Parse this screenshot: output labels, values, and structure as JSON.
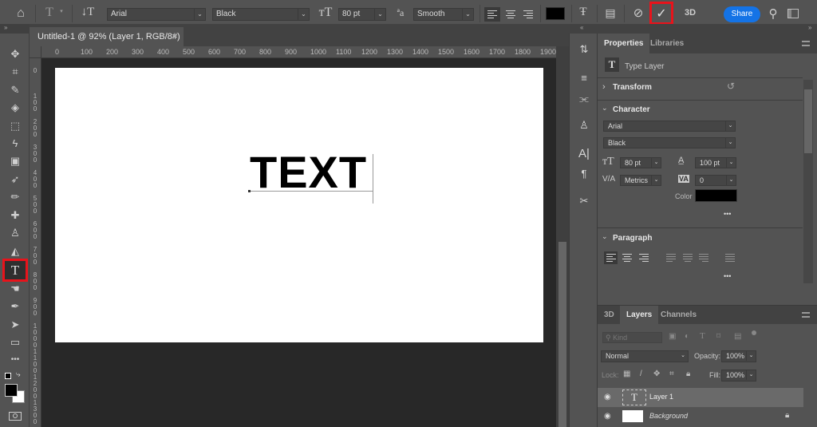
{
  "options_bar": {
    "home_icon": "home-icon",
    "tool_preset_icon": "type-tool-preset-icon",
    "orientation_icon": "text-orientation-icon",
    "font_family": "Arial",
    "font_style": "Black",
    "font_size_icon": "font-size-icon",
    "font_size": "80 pt",
    "antialias_icon": "antialias-icon",
    "antialias": "Smooth",
    "align_left_icon": "align-left-icon",
    "align_center_icon": "align-center-icon",
    "align_right_icon": "align-right-icon",
    "text_color": "#000000",
    "warp_icon": "warp-text-icon",
    "panels_icon": "character-panel-icon",
    "cancel_icon": "cancel-icon",
    "commit_icon": "checkmark-icon",
    "threed_label": "3D",
    "share_label": "Share",
    "search_icon": "search-icon",
    "workspace_icon": "workspace-icon"
  },
  "document": {
    "tab_title": "Untitled-1 @ 92% (Layer 1, RGB/8#)",
    "close_glyph": "×",
    "canvas_text": "TEXT",
    "h_ruler": [
      "0",
      "100",
      "200",
      "300",
      "400",
      "500",
      "600",
      "700",
      "800",
      "900",
      "1000",
      "1100",
      "1200",
      "1300",
      "1400",
      "1500",
      "1600",
      "1700",
      "1800",
      "1900"
    ],
    "v_ruler": [
      "0",
      "100",
      "200",
      "300",
      "400",
      "500",
      "600",
      "700",
      "800",
      "900",
      "1000",
      "1100",
      "1200",
      "1300"
    ]
  },
  "toolbar": {
    "collapse": "»",
    "tools": [
      {
        "name": "move-tool",
        "glyph": "✥"
      },
      {
        "name": "crop-tool",
        "glyph": "⌗"
      },
      {
        "name": "eyedropper-tool",
        "glyph": "✎"
      },
      {
        "name": "paint-bucket-tool",
        "glyph": "◇"
      },
      {
        "name": "marquee-tool",
        "glyph": "⬚"
      },
      {
        "name": "lasso-tool",
        "glyph": "ϟ"
      },
      {
        "name": "object-selection-tool",
        "glyph": "▣"
      },
      {
        "name": "brush-sampler-tool",
        "glyph": "➶"
      },
      {
        "name": "brush-tool",
        "glyph": "✏"
      },
      {
        "name": "healing-tool",
        "glyph": "✚"
      },
      {
        "name": "clone-stamp-tool",
        "glyph": "♙"
      },
      {
        "name": "eraser-tool",
        "glyph": "◭"
      },
      {
        "name": "type-tool",
        "glyph": "T"
      },
      {
        "name": "smudge-tool",
        "glyph": "☚"
      },
      {
        "name": "pen-tool",
        "glyph": "✒"
      },
      {
        "name": "path-selection-tool",
        "glyph": "➤"
      },
      {
        "name": "rectangle-tool",
        "glyph": "▭"
      },
      {
        "name": "more-tools",
        "glyph": "•••"
      }
    ],
    "foreground_color": "#000000",
    "background_color": "#ffffff"
  },
  "properties": {
    "tabs": [
      "Properties",
      "Libraries"
    ],
    "layer_type": "Type Layer",
    "transform_label": "Transform",
    "character_label": "Character",
    "font_family": "Arial",
    "font_style": "Black",
    "font_size": "80 pt",
    "leading": "100 pt",
    "kerning": "Metrics",
    "tracking": "0",
    "color_label": "Color",
    "color": "#000000",
    "more": "•••",
    "paragraph_label": "Paragraph",
    "paragraph_more": "•••"
  },
  "layers": {
    "tabs": [
      "3D",
      "Layers",
      "Channels"
    ],
    "filter_placeholder": "Kind",
    "blend_mode": "Normal",
    "opacity_label": "Opacity:",
    "opacity": "100%",
    "lock_label": "Lock:",
    "fill_label": "Fill:",
    "fill": "100%",
    "items": [
      {
        "name": "Layer 1",
        "type": "text",
        "visible": true,
        "selected": true
      },
      {
        "name": "Background",
        "type": "image",
        "visible": true,
        "locked": true
      }
    ]
  },
  "colors": {
    "highlight_red": "#e8131b",
    "share_blue": "#1473e6"
  }
}
